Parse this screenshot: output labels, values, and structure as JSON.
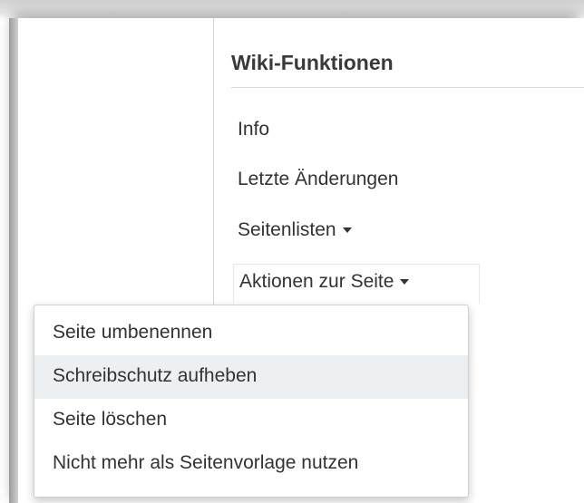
{
  "panel": {
    "title": "Wiki-Funktionen",
    "links": [
      {
        "label": "Info"
      },
      {
        "label": "Letzte Änderungen"
      },
      {
        "label": "Seitenlisten",
        "has_caret": true
      },
      {
        "label": "Aktionen zur Seite",
        "has_caret": true,
        "expanded": true
      }
    ]
  },
  "dropdown": {
    "items": [
      {
        "label": "Seite umbenennen",
        "highlighted": false
      },
      {
        "label": "Schreibschutz aufheben",
        "highlighted": true
      },
      {
        "label": "Seite löschen",
        "highlighted": false
      },
      {
        "label": "Nicht mehr als Seitenvorlage nutzen",
        "highlighted": false
      }
    ]
  },
  "colors": {
    "text": "#333333",
    "title": "#3a3a3a",
    "highlight": "#edf0f3",
    "divider": "#d6d6d6"
  },
  "icons": {
    "caret": "caret-down-icon"
  }
}
